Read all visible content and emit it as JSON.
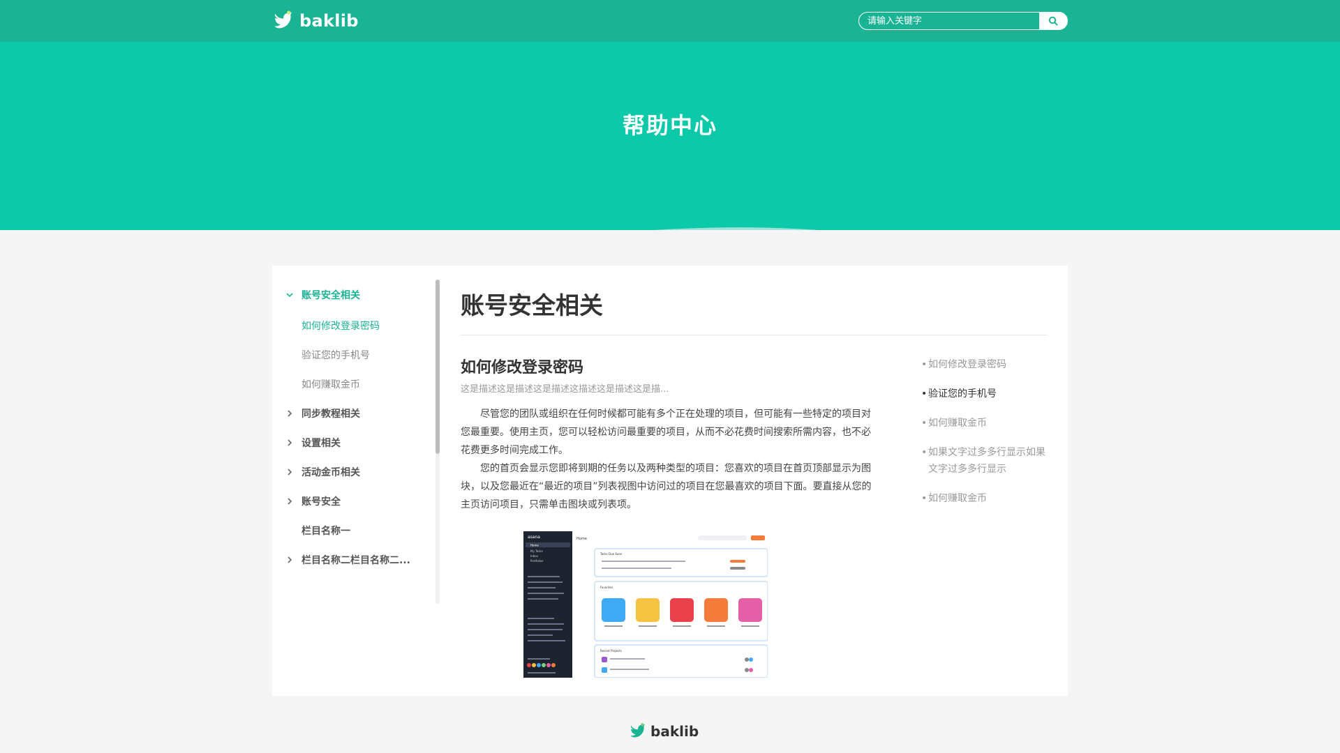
{
  "header": {
    "brand": "baklib",
    "search_placeholder": "请输入关键字"
  },
  "hero": {
    "title": "帮助中心"
  },
  "sidebar": {
    "items": [
      {
        "label": "账号安全相关",
        "type": "group",
        "expanded": true,
        "active": true
      },
      {
        "label": "如何修改登录密码",
        "type": "sub",
        "active": true
      },
      {
        "label": "验证您的手机号",
        "type": "sub"
      },
      {
        "label": "如何赚取金币",
        "type": "sub"
      },
      {
        "label": "同步教程相关",
        "type": "group"
      },
      {
        "label": "设置相关",
        "type": "group"
      },
      {
        "label": "活动金币相关",
        "type": "group"
      },
      {
        "label": "账号安全",
        "type": "group"
      },
      {
        "label": "栏目名称一",
        "type": "group",
        "no_chevron": true
      },
      {
        "label": "栏目名称二栏目名称二...",
        "type": "group"
      }
    ]
  },
  "main": {
    "page_title": "账号安全相关",
    "article_title": "如何修改登录密码",
    "description": "这是描述这是描述这是描述这描述这是描述这是描...",
    "paragraph1": "尽管您的团队或组织在任何时候都可能有多个正在处理的项目，但可能有一些特定的项目对您最重要。使用主页，您可以轻松访问最重要的项目，从而不必花费时间搜索所需内容，也不必花费更多时间完成工作。",
    "paragraph2": "您的首页会显示您即将到期的任务以及两种类型的项目：您喜欢的项目在首页顶部显示为图块，以及您最近在“最近的项目”列表视图中访问过的项目在您最喜欢的项目下面。要直接从您的主页访问项目，只需单击图块或列表项。",
    "screenshot": {
      "app_name": "asana",
      "page_label": "Home",
      "sections": [
        "Tasks Due Soon",
        "Favorites",
        "Recent Projects"
      ],
      "sidebar_labels": [
        "Home",
        "My Tasks",
        "Inbox",
        "Portfolios"
      ],
      "favorite_colors": [
        "#3fa9f5",
        "#f5c242",
        "#e8414b",
        "#f57c3a",
        "#e55fa6"
      ]
    }
  },
  "toc": {
    "items": [
      {
        "label": "如何修改登录密码"
      },
      {
        "label": "验证您的手机号",
        "current": true
      },
      {
        "label": "如何赚取金币"
      },
      {
        "label": "如果文字过多多行显示如果文字过多多行显示"
      },
      {
        "label": "如何赚取金币"
      }
    ]
  },
  "footer": {
    "brand": "baklib"
  },
  "colors": {
    "brand_green": "#1ab394",
    "hero_green": "#0bc9a9",
    "wave_light": "#9ee5d8"
  }
}
